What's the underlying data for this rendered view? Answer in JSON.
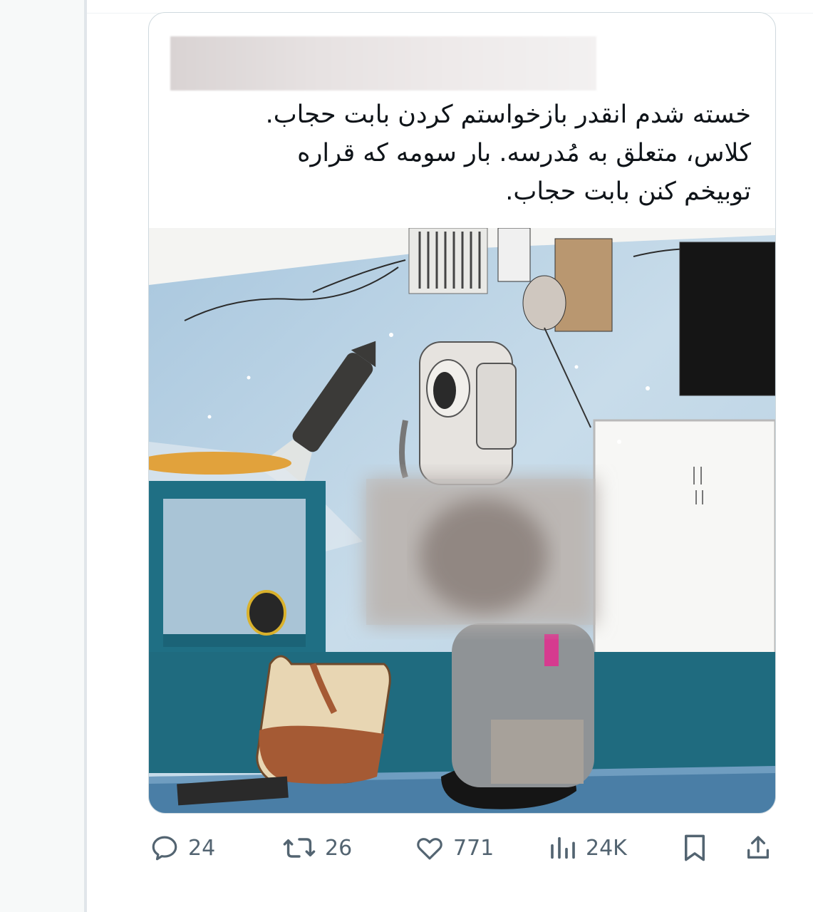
{
  "tweet": {
    "lines": [
      "خسته شدم انقدر بازخواستم کردن بابت حجاب.",
      "کلاس، متعلق به مُدرسه. بار سومه که قراره",
      "توبیخم کنن بابت حجاب."
    ]
  },
  "actions": {
    "replies": "24",
    "reposts": "26",
    "likes": "771",
    "views": "24K"
  },
  "icons": [
    "reply-icon",
    "repost-icon",
    "like-icon",
    "views-icon",
    "bookmark-icon",
    "share-icon"
  ],
  "colors": {
    "icon_gray": "#536471",
    "border": "#cfd9de"
  }
}
